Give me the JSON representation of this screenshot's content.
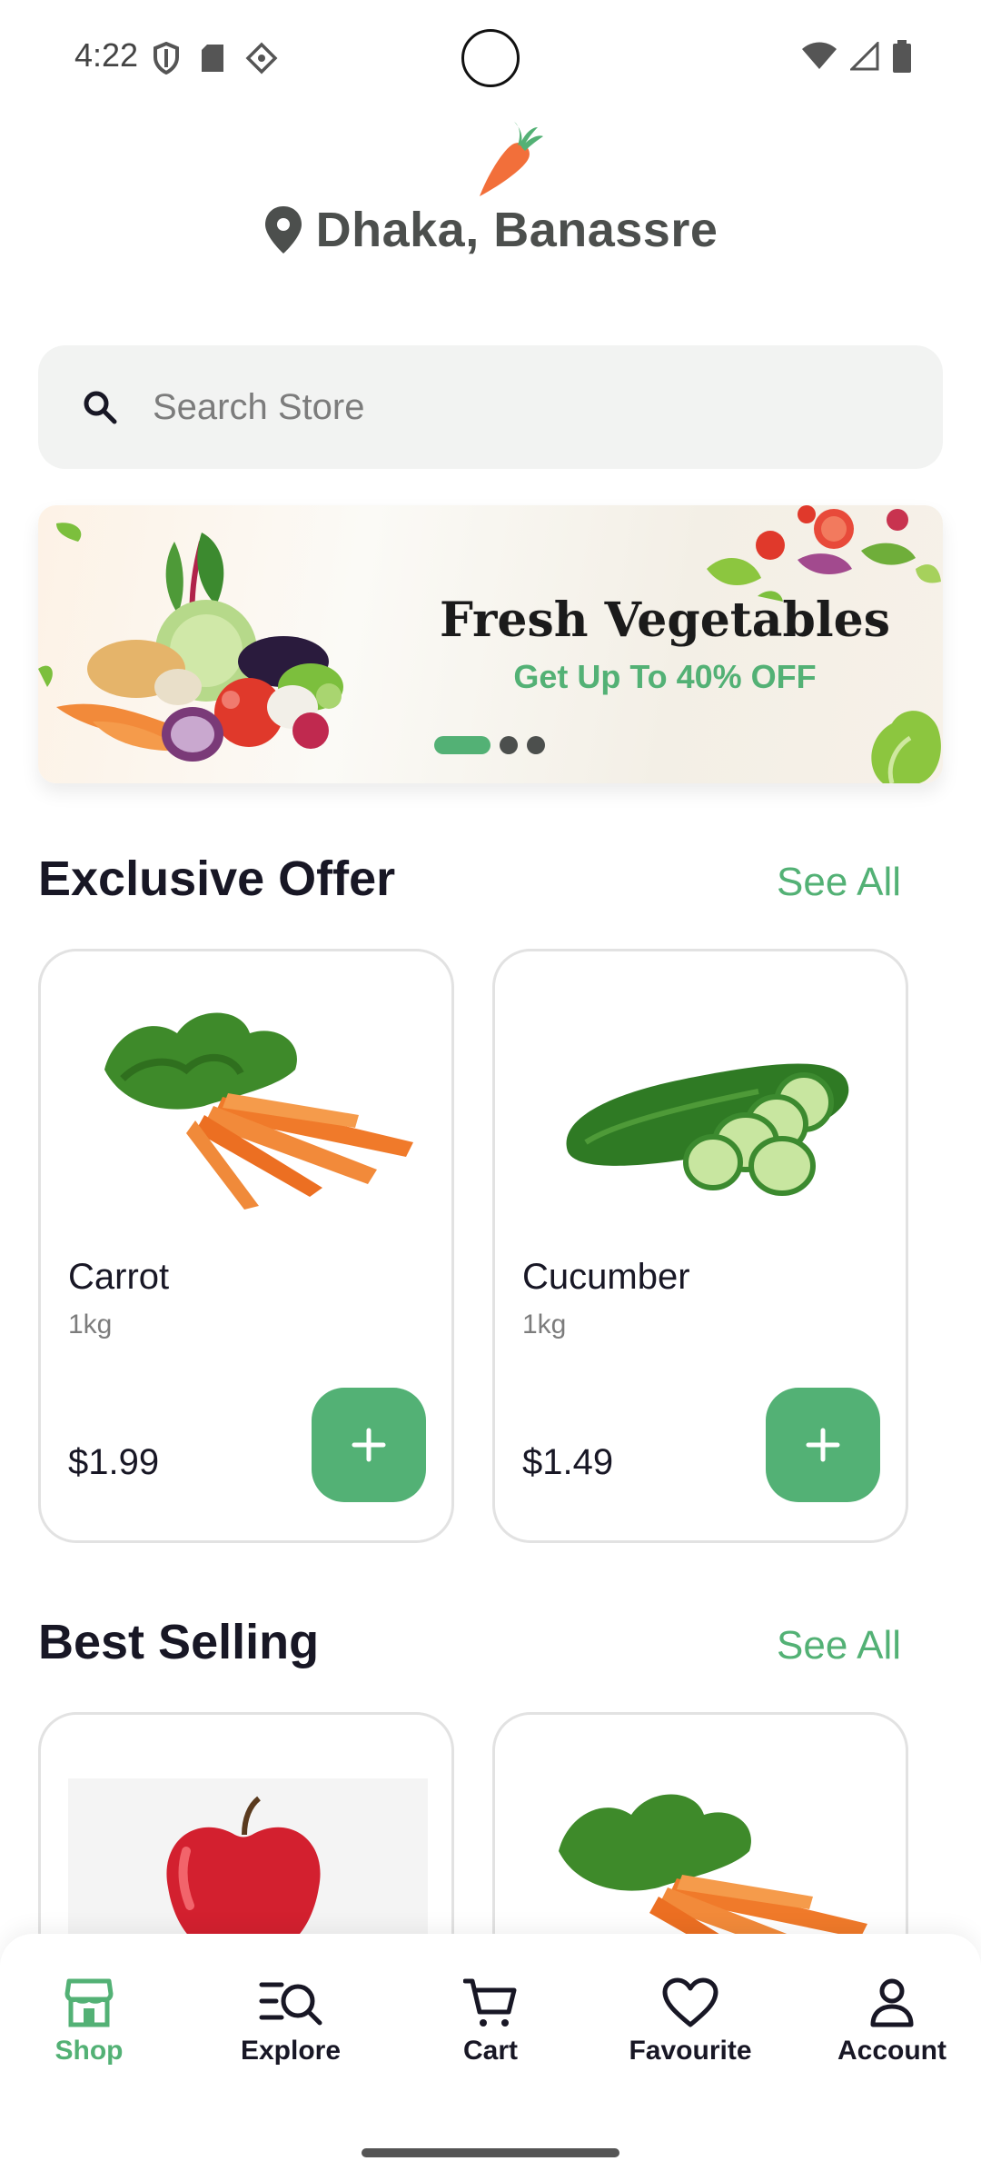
{
  "status_bar": {
    "time": "4:22"
  },
  "header": {
    "location": "Dhaka, Banassre"
  },
  "search": {
    "placeholder": "Search Store"
  },
  "banner": {
    "title": "Fresh Vegetables",
    "subtitle": "Get Up To 40% OFF",
    "page_count": 3,
    "active_page": 1
  },
  "exclusive_offer": {
    "title": "Exclusive Offer",
    "see_all": "See All",
    "products": [
      {
        "name": "Carrot",
        "unit": "1kg",
        "price": "$1.99",
        "image": "carrot-image"
      },
      {
        "name": "Cucumber",
        "unit": "1kg",
        "price": "$1.49",
        "image": "cucumber-image"
      }
    ]
  },
  "best_selling": {
    "title": "Best Selling",
    "see_all": "See All",
    "products": [
      {
        "image": "apple-image"
      },
      {
        "image": "carrot-image"
      }
    ]
  },
  "bottom_nav": {
    "items": [
      {
        "label": "Shop",
        "icon": "shop-icon",
        "active": true
      },
      {
        "label": "Explore",
        "icon": "explore-icon",
        "active": false
      },
      {
        "label": "Cart",
        "icon": "cart-icon",
        "active": false
      },
      {
        "label": "Favourite",
        "icon": "heart-icon",
        "active": false
      },
      {
        "label": "Account",
        "icon": "account-icon",
        "active": false
      }
    ]
  },
  "colors": {
    "accent": "#53B175",
    "text_primary": "#181725",
    "text_secondary": "#7C7C7C",
    "search_bg": "#F2F3F2",
    "card_border": "#E2E2E2"
  }
}
